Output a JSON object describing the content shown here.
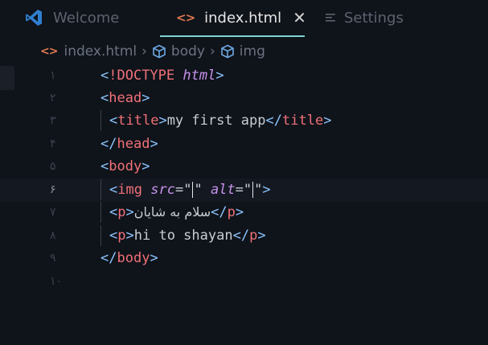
{
  "tabs": [
    {
      "label": "Welcome",
      "icon": "vscode-icon",
      "active": false
    },
    {
      "label": "index.html",
      "icon": "html-code-icon",
      "active": true
    },
    {
      "label": "Settings",
      "icon": "settings-icon",
      "active": false
    }
  ],
  "breadcrumb": [
    "index.html",
    "body",
    "img"
  ],
  "line_numbers": [
    "١",
    "٢",
    "٣",
    "۴",
    "۵",
    "۶",
    "٧",
    "٨",
    "٩",
    "١٠"
  ],
  "code": {
    "l1_a": "<",
    "l1_b": "!DOCTYPE",
    "l1_c": "html",
    "l1_d": ">",
    "lt": "<",
    "gt": ">",
    "close_lt": "</",
    "head": "head",
    "title": "title",
    "body": "body",
    "img": "img",
    "p": "p",
    "title_text": "my first app",
    "src": "src",
    "alt": "alt",
    "eq": "=",
    "quote": "\"",
    "p1_text": "سلام به شایان",
    "p2_text": "hi to shayan"
  },
  "colors": {
    "accent": "#7fd4d4",
    "tag": "#f07178",
    "punct": "#8cc6ff",
    "attr": "#c792ea",
    "html_icon": "#e07a4f"
  }
}
